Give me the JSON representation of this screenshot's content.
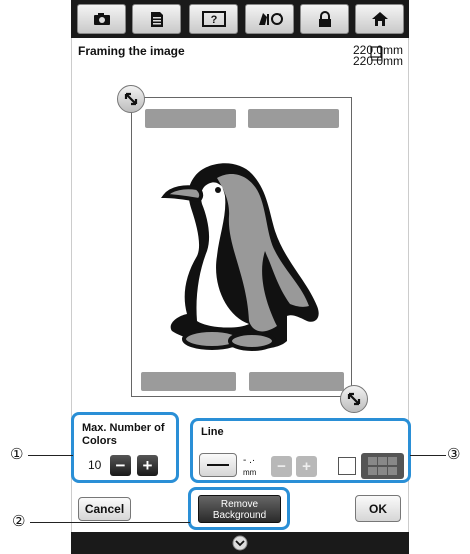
{
  "toolbar": {
    "icons": [
      "camera-icon",
      "document-icon",
      "help-icon",
      "embroidery-settings-icon",
      "lock-icon",
      "home-icon"
    ]
  },
  "header": {
    "title": "Framing the image",
    "width": "220.0mm",
    "height": "220.0mm"
  },
  "max_colors": {
    "label_line1": "Max. Number of",
    "label_line2": "Colors",
    "value": "10"
  },
  "line_panel": {
    "label": "Line",
    "unit": "mm",
    "dash": "- .·"
  },
  "buttons": {
    "cancel": "Cancel",
    "remove_background_line1": "Remove",
    "remove_background_line2": "Background",
    "ok": "OK"
  },
  "callouts": {
    "one": "①",
    "two": "②",
    "three": "③"
  },
  "colors": {
    "accent": "#2a8fd6",
    "toolbar": "#1a1a1a"
  }
}
